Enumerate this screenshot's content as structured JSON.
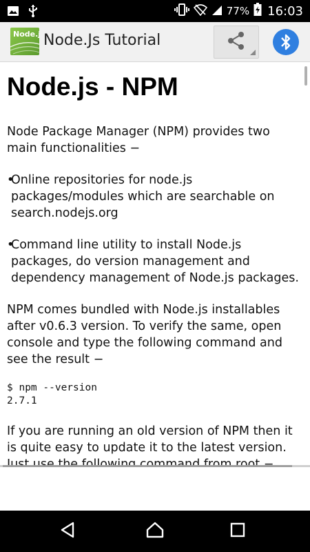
{
  "status_bar": {
    "battery_percent": "77%",
    "time": "16:03"
  },
  "app_bar": {
    "logo_text": "Node.js",
    "title": "Node.Js Tutorial"
  },
  "article": {
    "title": "Node.js - NPM",
    "intro": "Node Package Manager (NPM) provides two main functionalities −",
    "bullets": [
      "Online repositories for node.js packages/modules which are searchable on search.nodejs.org",
      "Command line utility to install Node.js packages, do version management and dependency management of Node.js packages."
    ],
    "para2": "NPM comes bundled with Node.js installables after v0.6.3 version. To verify the same, open console and type the following command and see the result −",
    "code": "$ npm --version\n2.7.1",
    "para3": "If you are running an old version of NPM then it is quite easy to update it to the latest version. Just use the following command from root −"
  },
  "colors": {
    "status_bar_bg": "#000000",
    "app_bar_bg": "#f1f1f1",
    "bluetooth_accent": "#2f7fe0",
    "nodejs_green": "#8cc84b"
  }
}
